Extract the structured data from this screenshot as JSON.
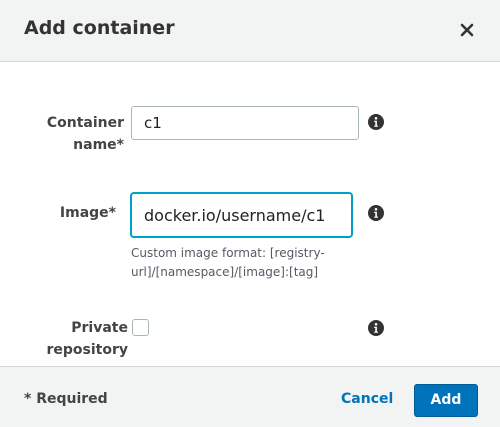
{
  "dialog": {
    "title": "Add container"
  },
  "form": {
    "container_name": {
      "label_line1": "Container",
      "label_line2": "name*",
      "value": "c1"
    },
    "image": {
      "label": "Image*",
      "value": "docker.io/username/c1",
      "help_line1": "Custom image format: [registry-",
      "help_line2": "url]/[namespace]/[image]:[tag]"
    },
    "private_repository": {
      "label_line1": "Private",
      "label_line2": "repository",
      "checked": false
    }
  },
  "footer": {
    "required_note": "* Required",
    "cancel_label": "Cancel",
    "add_label": "Add"
  },
  "colors": {
    "primary": "#0073bb",
    "focus": "#00a1c9",
    "header_bg": "#f2f3f3"
  },
  "icons": {
    "close": "close-icon",
    "info": "info-icon"
  }
}
